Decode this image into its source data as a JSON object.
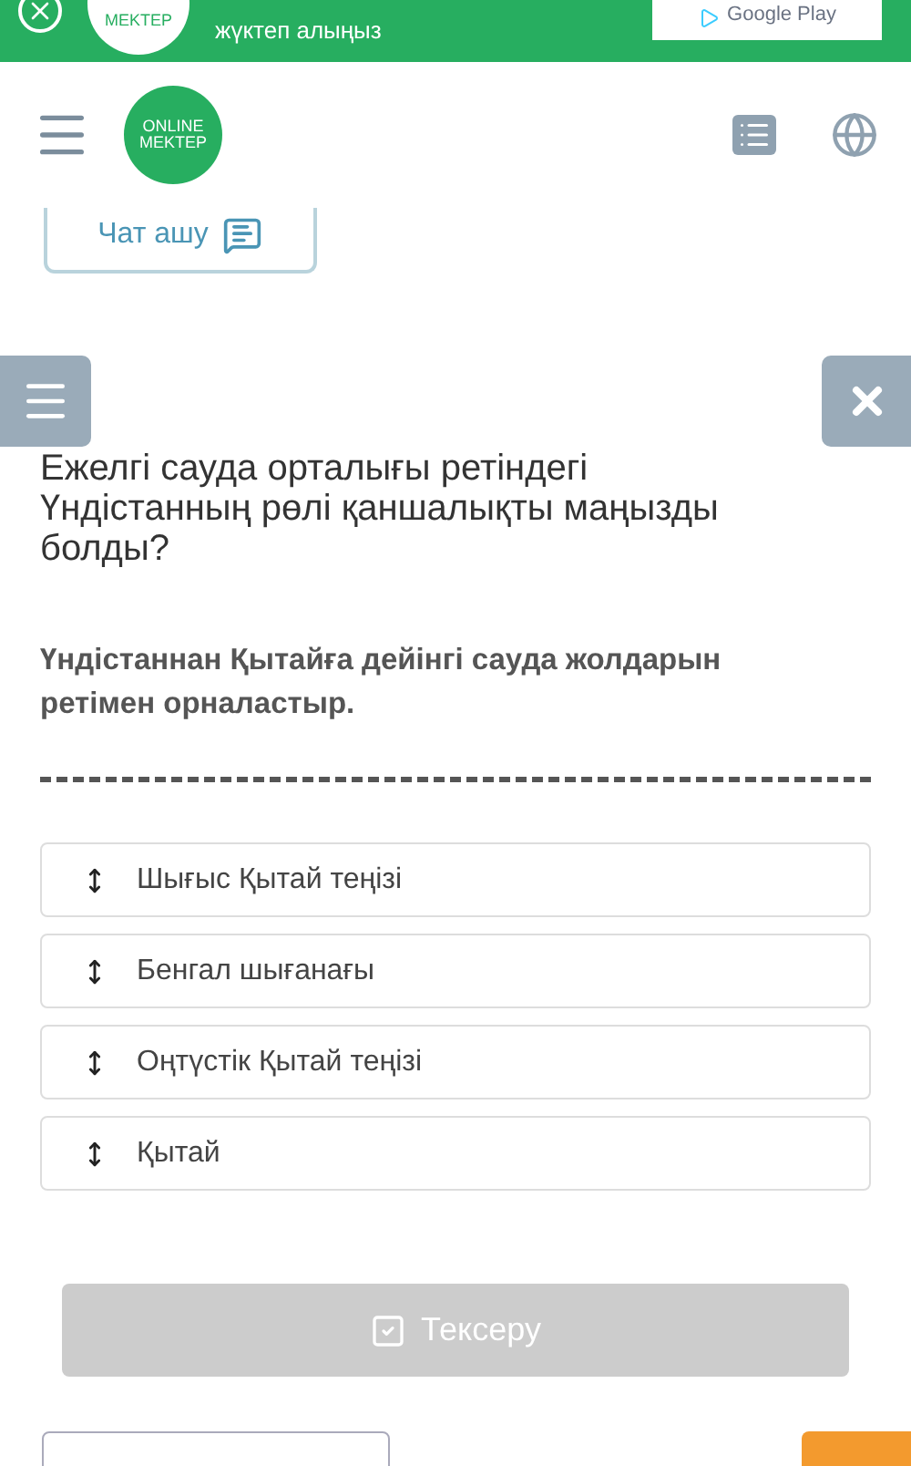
{
  "banner": {
    "text": "жүктеп алыңыз",
    "logo": "MEKTEP",
    "store_button": "Google Play"
  },
  "header": {
    "logo": [
      "ONLINE",
      "MEKTEP"
    ]
  },
  "chat_button": {
    "label": "Чат ашу"
  },
  "question": {
    "title": "Ежелгі сауда орталығы ретіндегі Үндістанның рөлі қаншалықты маңызды болды?",
    "instruction": "Үндістаннан Қытайға дейінгі сауда жолдарын ретімен орналастыр."
  },
  "items": [
    {
      "label": "Шығыс Қытай теңізі"
    },
    {
      "label": "Бенгал шығанағы"
    },
    {
      "label": "Оңтүстік Қытай теңізі"
    },
    {
      "label": "Қытай"
    }
  ],
  "check_button": {
    "label": "Тексеру",
    "disabled": true
  }
}
